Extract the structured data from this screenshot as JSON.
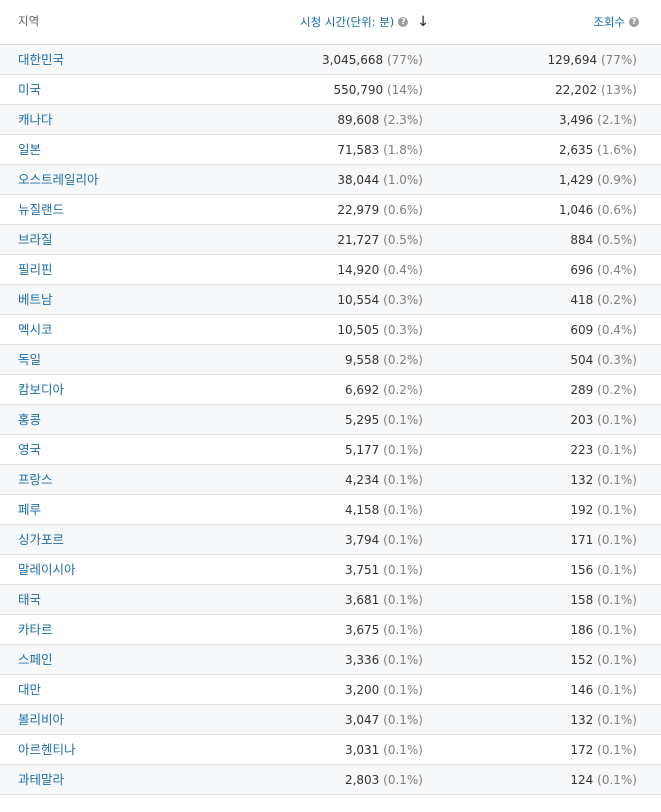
{
  "header": {
    "region_label": "지역",
    "watch_time_label": "시청 시간(단위: 분)",
    "views_label": "조회수",
    "help_glyph": "?",
    "sort_glyph": "↓"
  },
  "rows": [
    {
      "region": "대한민국",
      "watch": "3,045,668",
      "watch_pct": "(77%)",
      "views": "129,694",
      "views_pct": "(77%)"
    },
    {
      "region": "미국",
      "watch": "550,790",
      "watch_pct": "(14%)",
      "views": "22,202",
      "views_pct": "(13%)"
    },
    {
      "region": "캐나다",
      "watch": "89,608",
      "watch_pct": "(2.3%)",
      "views": "3,496",
      "views_pct": "(2.1%)"
    },
    {
      "region": "일본",
      "watch": "71,583",
      "watch_pct": "(1.8%)",
      "views": "2,635",
      "views_pct": "(1.6%)"
    },
    {
      "region": "오스트레일리아",
      "watch": "38,044",
      "watch_pct": "(1.0%)",
      "views": "1,429",
      "views_pct": "(0.9%)"
    },
    {
      "region": "뉴질랜드",
      "watch": "22,979",
      "watch_pct": "(0.6%)",
      "views": "1,046",
      "views_pct": "(0.6%)"
    },
    {
      "region": "브라질",
      "watch": "21,727",
      "watch_pct": "(0.5%)",
      "views": "884",
      "views_pct": "(0.5%)"
    },
    {
      "region": "필리핀",
      "watch": "14,920",
      "watch_pct": "(0.4%)",
      "views": "696",
      "views_pct": "(0.4%)"
    },
    {
      "region": "베트남",
      "watch": "10,554",
      "watch_pct": "(0.3%)",
      "views": "418",
      "views_pct": "(0.2%)"
    },
    {
      "region": "멕시코",
      "watch": "10,505",
      "watch_pct": "(0.3%)",
      "views": "609",
      "views_pct": "(0.4%)"
    },
    {
      "region": "독일",
      "watch": "9,558",
      "watch_pct": "(0.2%)",
      "views": "504",
      "views_pct": "(0.3%)"
    },
    {
      "region": "캄보디아",
      "watch": "6,692",
      "watch_pct": "(0.2%)",
      "views": "289",
      "views_pct": "(0.2%)"
    },
    {
      "region": "홍콩",
      "watch": "5,295",
      "watch_pct": "(0.1%)",
      "views": "203",
      "views_pct": "(0.1%)"
    },
    {
      "region": "영국",
      "watch": "5,177",
      "watch_pct": "(0.1%)",
      "views": "223",
      "views_pct": "(0.1%)"
    },
    {
      "region": "프랑스",
      "watch": "4,234",
      "watch_pct": "(0.1%)",
      "views": "132",
      "views_pct": "(0.1%)"
    },
    {
      "region": "페루",
      "watch": "4,158",
      "watch_pct": "(0.1%)",
      "views": "192",
      "views_pct": "(0.1%)"
    },
    {
      "region": "싱가포르",
      "watch": "3,794",
      "watch_pct": "(0.1%)",
      "views": "171",
      "views_pct": "(0.1%)"
    },
    {
      "region": "말레이시아",
      "watch": "3,751",
      "watch_pct": "(0.1%)",
      "views": "156",
      "views_pct": "(0.1%)"
    },
    {
      "region": "태국",
      "watch": "3,681",
      "watch_pct": "(0.1%)",
      "views": "158",
      "views_pct": "(0.1%)"
    },
    {
      "region": "카타르",
      "watch": "3,675",
      "watch_pct": "(0.1%)",
      "views": "186",
      "views_pct": "(0.1%)"
    },
    {
      "region": "스페인",
      "watch": "3,336",
      "watch_pct": "(0.1%)",
      "views": "152",
      "views_pct": "(0.1%)"
    },
    {
      "region": "대만",
      "watch": "3,200",
      "watch_pct": "(0.1%)",
      "views": "146",
      "views_pct": "(0.1%)"
    },
    {
      "region": "볼리비아",
      "watch": "3,047",
      "watch_pct": "(0.1%)",
      "views": "132",
      "views_pct": "(0.1%)"
    },
    {
      "region": "아르헨티나",
      "watch": "3,031",
      "watch_pct": "(0.1%)",
      "views": "172",
      "views_pct": "(0.1%)"
    },
    {
      "region": "과테말라",
      "watch": "2,803",
      "watch_pct": "(0.1%)",
      "views": "124",
      "views_pct": "(0.1%)"
    }
  ]
}
